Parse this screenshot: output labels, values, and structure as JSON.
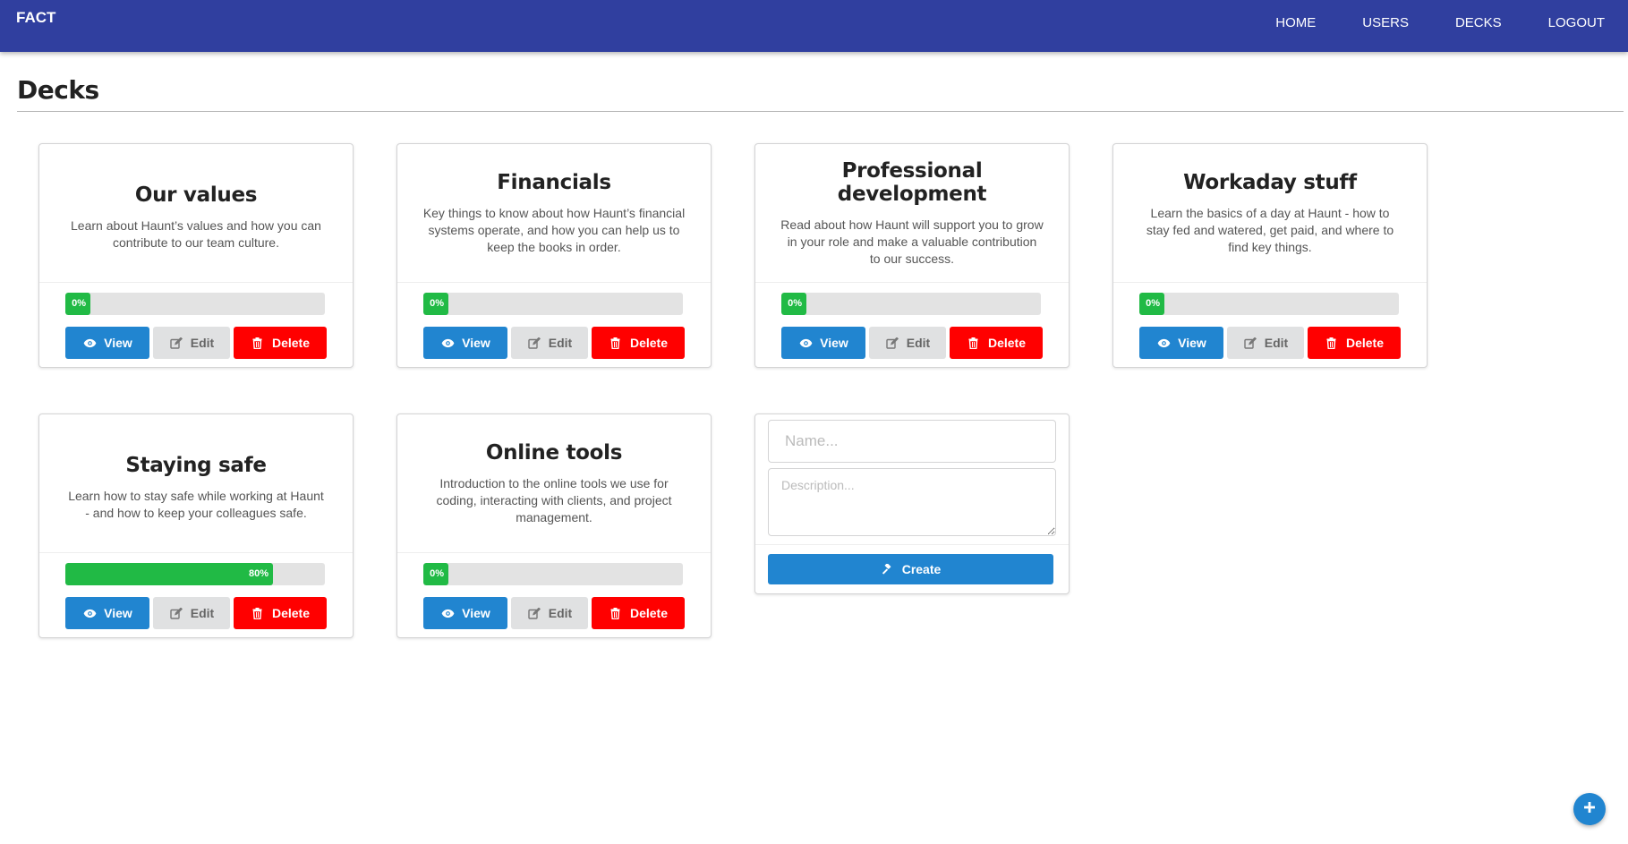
{
  "app": {
    "brand": "FACT",
    "nav": [
      "HOME",
      "USERS",
      "DECKS",
      "LOGOUT"
    ]
  },
  "page": {
    "title": "Decks"
  },
  "decks": [
    {
      "title": "Our values",
      "description": "Learn about Haunt’s values and how you can contribute to our team culture.",
      "progress": 0,
      "progress_label": "0%"
    },
    {
      "title": "Financials",
      "description": "Key things to know about how Haunt’s financial systems operate, and how you can help us to keep the books in order.",
      "progress": 0,
      "progress_label": "0%"
    },
    {
      "title": "Professional development",
      "description": "Read about how Haunt will support you to grow in your role and make a valuable contribution to our success.",
      "progress": 0,
      "progress_label": "0%"
    },
    {
      "title": "Workaday stuff",
      "description": "Learn the basics of a day at Haunt - how to stay fed and watered, get paid, and where to find key things.",
      "progress": 0,
      "progress_label": "0%"
    },
    {
      "title": "Staying safe",
      "description": "Learn how to stay safe while working at Haunt - and how to keep your colleagues safe.",
      "progress": 80,
      "progress_label": "80%"
    },
    {
      "title": "Online tools",
      "description": "Introduction to the online tools we use for coding, interacting with clients, and project management.",
      "progress": 0,
      "progress_label": "0%"
    }
  ],
  "actions": {
    "view_label": "View",
    "edit_label": "Edit",
    "delete_label": "Delete"
  },
  "create_form": {
    "name_placeholder": "Name...",
    "description_placeholder": "Description...",
    "create_label": "Create"
  },
  "icons": {
    "view": "eye-icon",
    "edit": "edit-icon",
    "delete": "trash-icon",
    "create": "gavel-icon",
    "fab": "plus-icon"
  },
  "colors": {
    "navbar": "#303f9f",
    "primary": "#2185d0",
    "danger": "#ff0000",
    "success": "#21ba45",
    "neutral": "#e0e1e2"
  }
}
